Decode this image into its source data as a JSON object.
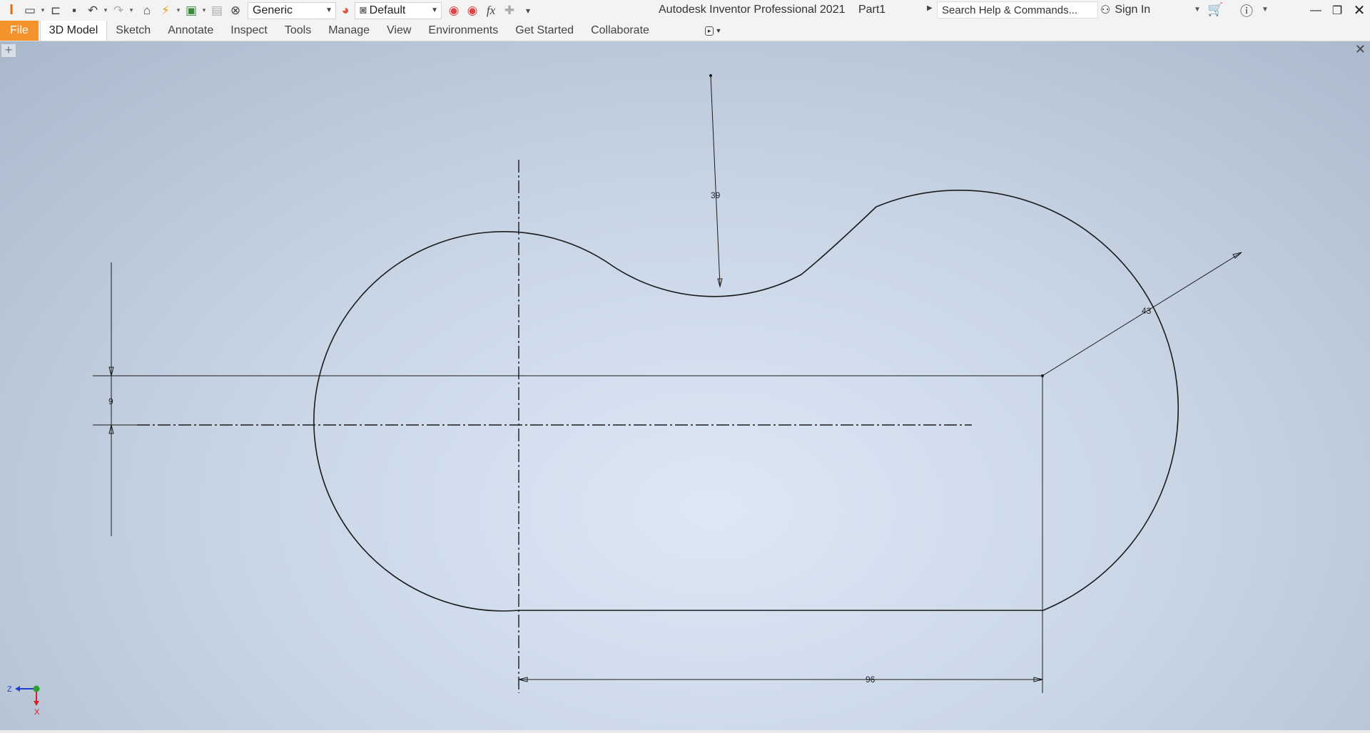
{
  "app": {
    "name": "Autodesk Inventor Professional 2021",
    "document": "Part1"
  },
  "quick_access": {
    "material": "Generic",
    "appearance": "Default"
  },
  "search": {
    "placeholder": "Search Help & Commands..."
  },
  "account": {
    "sign_in": "Sign In"
  },
  "ribbon": {
    "file": "File",
    "tabs": [
      "3D Model",
      "Sketch",
      "Annotate",
      "Inspect",
      "Tools",
      "Manage",
      "View",
      "Environments",
      "Get Started",
      "Collaborate"
    ],
    "active_tab": "3D Model"
  },
  "sketch": {
    "dimensions": {
      "arc_radius_top": "39",
      "arc_radius_right": "43",
      "vertical_offset": "9",
      "horizontal_length": "96"
    }
  },
  "triad": {
    "z": "Z",
    "x": "X"
  },
  "colors": {
    "file_tab": "#f4922b",
    "canvas_center": "#dde8f6",
    "canvas_edge": "#a9b8cb",
    "x_axis": "#d42020",
    "z_axis": "#1f3fd0",
    "origin": "#2aa02a"
  },
  "icons": [
    "inventor-logo-icon",
    "new-icon",
    "open-icon",
    "save-icon",
    "undo-icon",
    "redo-icon",
    "home-icon",
    "update-icon",
    "measure-icon",
    "visual-style-icon",
    "clear-appearance-icon",
    "color-wheel-icon",
    "default-sphere-icon",
    "adjust-appearance-icon",
    "clear-override-icon",
    "fx-parameters-icon",
    "add-icon",
    "customize-icon",
    "user-icon",
    "cart-icon",
    "help-icon",
    "minimize-icon",
    "restore-icon",
    "close-icon"
  ]
}
